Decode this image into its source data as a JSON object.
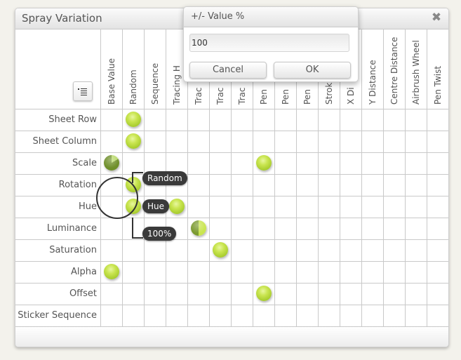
{
  "window": {
    "title": "Spray Variation",
    "close_icon": "close-x-icon"
  },
  "menu_button_icon": "list-menu-icon",
  "columns": [
    "Base Value",
    "Random",
    "Sequence",
    "Tracing H",
    "Trac",
    "Trac",
    "Trac",
    "Pen",
    "Pen",
    "Pen",
    "Strok",
    "X Di",
    "Y Distance",
    "Centre Distance",
    "Airbrush Wheel",
    "Pen Twist"
  ],
  "rows": [
    "Sheet Row",
    "Sheet Column",
    "Scale",
    "Rotation",
    "Hue",
    "Luminance",
    "Saturation",
    "Alpha",
    "Offset",
    "Sticker Sequence"
  ],
  "dots": [
    {
      "row": 0,
      "col": 1,
      "style": "full"
    },
    {
      "row": 1,
      "col": 1,
      "style": "full"
    },
    {
      "row": 2,
      "col": 0,
      "style": "partial"
    },
    {
      "row": 2,
      "col": 7,
      "style": "full"
    },
    {
      "row": 3,
      "col": 1,
      "style": "full"
    },
    {
      "row": 4,
      "col": 1,
      "style": "full"
    },
    {
      "row": 4,
      "col": 3,
      "style": "full"
    },
    {
      "row": 5,
      "col": 4,
      "style": "half"
    },
    {
      "row": 6,
      "col": 5,
      "style": "full"
    },
    {
      "row": 7,
      "col": 0,
      "style": "full"
    },
    {
      "row": 8,
      "col": 7,
      "style": "full"
    }
  ],
  "selection": {
    "top_label": "Random",
    "middle_label": "Hue",
    "bottom_label": "100%"
  },
  "dialog": {
    "title": "+/- Value %",
    "input_value": "100",
    "cancel_label": "Cancel",
    "ok_label": "OK"
  }
}
